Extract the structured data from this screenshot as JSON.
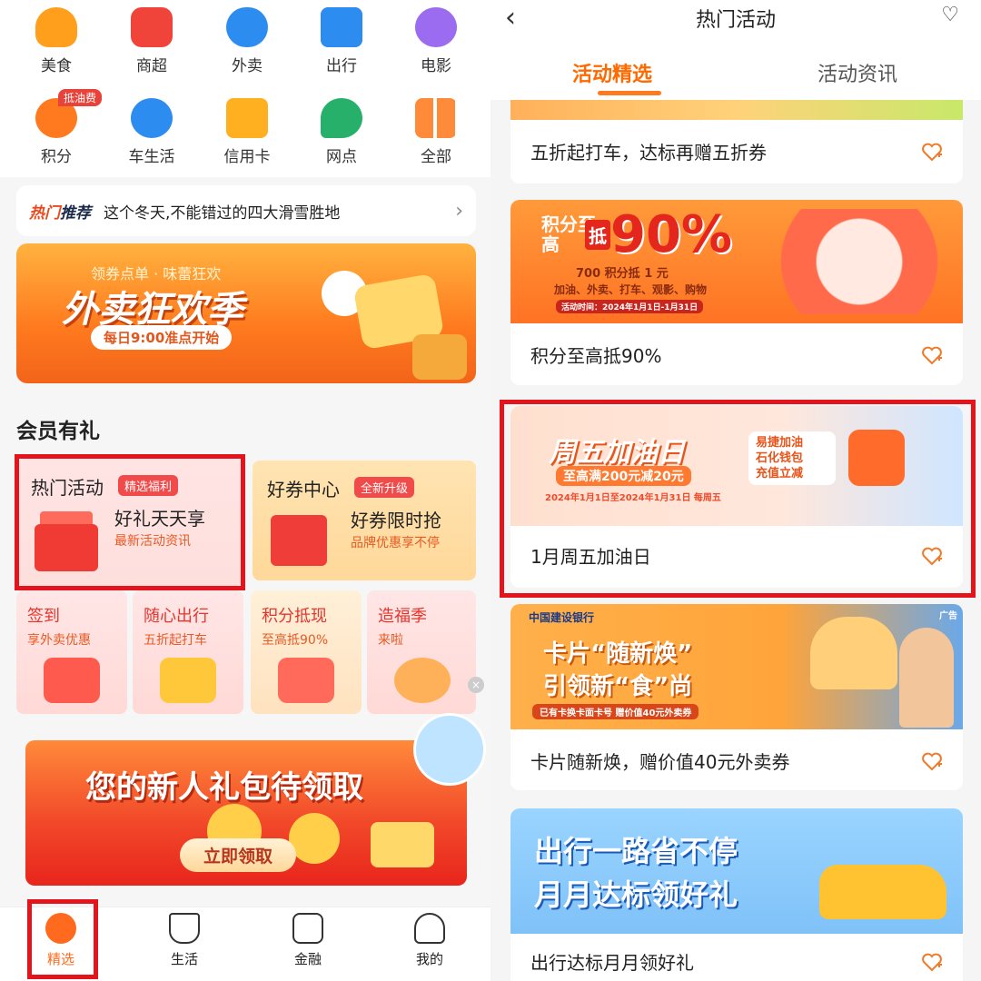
{
  "left": {
    "icons": [
      {
        "label": "美食",
        "icon": "food-icon",
        "color": "#ff9f1c"
      },
      {
        "label": "商超",
        "icon": "store-icon",
        "color": "#f0443b"
      },
      {
        "label": "外卖",
        "icon": "scooter-icon",
        "color": "#2d8cf0"
      },
      {
        "label": "出行",
        "icon": "bus-icon",
        "color": "#2d8cf0"
      },
      {
        "label": "电影",
        "icon": "film-reel-icon",
        "color": "#9b6cf0"
      },
      {
        "label": "积分",
        "icon": "star-coin-icon",
        "color": "#ff7a1e"
      },
      {
        "label": "车生活",
        "icon": "steering-wheel-icon",
        "color": "#2d8cf0"
      },
      {
        "label": "信用卡",
        "icon": "credit-card-icon",
        "color": "#ffb020"
      },
      {
        "label": "网点",
        "icon": "map-pin-icon",
        "color": "#27b06a"
      },
      {
        "label": "全部",
        "icon": "grid-icon",
        "color": "#ff8a3a"
      }
    ],
    "oil_tag": "抵油费",
    "hot": {
      "logo_a": "热门",
      "logo_b": "推荐",
      "text": "这个冬天,不能错过的四大滑雪胜地"
    },
    "banner": {
      "sub": "领券点单 · 味蕾狂欢",
      "title": "外卖狂欢季",
      "pill": "每日9:00准点开始"
    },
    "section_title": "会员有礼",
    "card1": {
      "title": "热门活动",
      "badge": "精选福利",
      "main": "好礼天天享",
      "sub": "最新活动资讯"
    },
    "card2": {
      "title": "好券中心",
      "badge": "全新升级",
      "main": "好券限时抢",
      "sub": "品牌优惠享不停"
    },
    "small": [
      {
        "title": "签到",
        "sub": "享外卖优惠"
      },
      {
        "title": "随心出行",
        "sub": "五折起打车"
      },
      {
        "title": "积分抵现",
        "sub": "至高抵90%"
      },
      {
        "title": "造福季",
        "sub": "来啦"
      }
    ],
    "newuser": {
      "title": "您的新人礼包待领取",
      "button": "立即领取"
    },
    "nav": [
      {
        "label": "精选",
        "icon": "home-icon"
      },
      {
        "label": "生活",
        "icon": "coffee-cup-icon"
      },
      {
        "label": "金融",
        "icon": "wallet-icon"
      },
      {
        "label": "我的",
        "icon": "person-icon"
      }
    ]
  },
  "right": {
    "title": "热门活动",
    "tabs": [
      "活动精选",
      "活动资讯"
    ],
    "cards": [
      {
        "label": "五折起打车，达标再赠五折券"
      },
      {
        "label": "积分至高抵90%",
        "img_a": "积分至高",
        "img_b": "抵",
        "img_c": "90%",
        "img_d": "700 积分抵 1 元",
        "img_e": "加油、外卖、打车、观影、购物",
        "img_f": "活动时间：2024年1月1日-1月31日"
      },
      {
        "label": "1月周五加油日",
        "img_a": "周五加油日",
        "img_b": "至高满200元减20元",
        "img_c": "2024年1月1日至2024年1月31日 每周五",
        "img_d": "易捷加油\n石化钱包\n充值立减"
      },
      {
        "label": "卡片随新焕，赠价值40元外卖券",
        "img_a": "中国建设银行",
        "img_b": "卡片“随新焕”",
        "img_c": "引领新“食”尚",
        "img_d": "已有卡换卡面卡号 赠价值40元外卖券",
        "img_e": "广告"
      },
      {
        "label": "出行达标月月领好礼",
        "img_a": "出行一路省不停",
        "img_b": "月月达标领好礼"
      }
    ]
  }
}
